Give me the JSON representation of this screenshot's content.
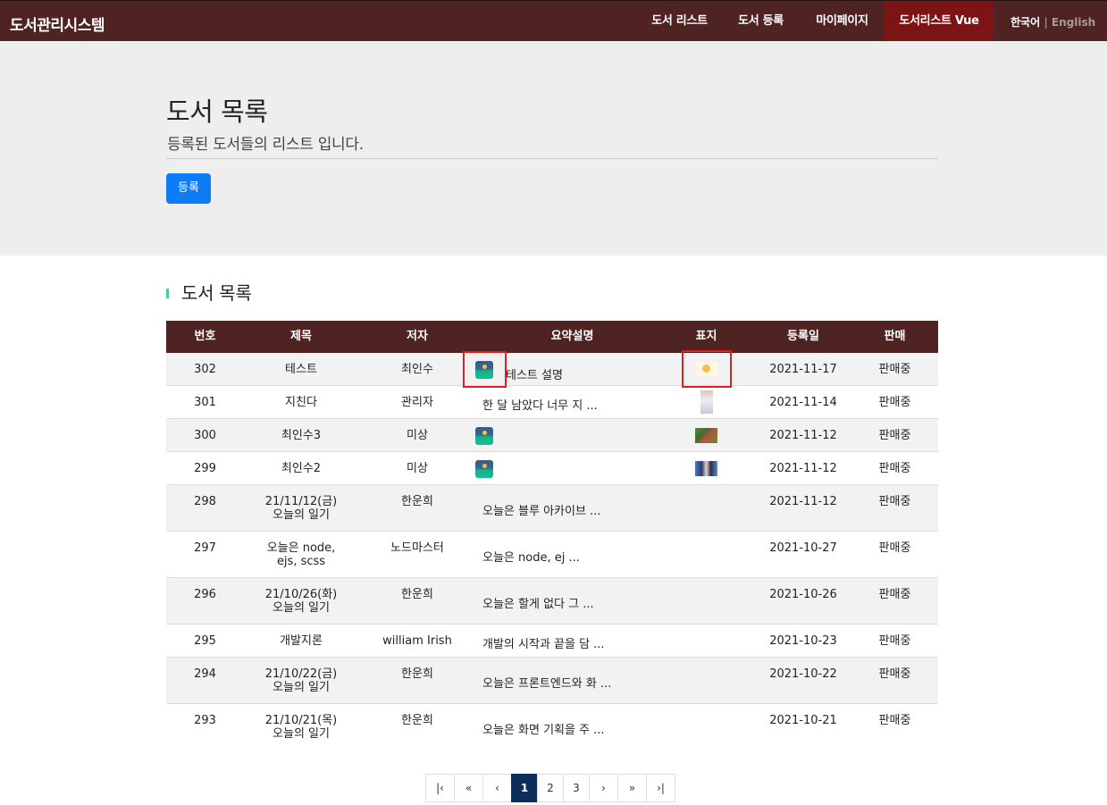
{
  "nav": {
    "brand": "도서관리시스템",
    "items": [
      "도서 리스트",
      "도서 등록",
      "마이페이지",
      "도서리스트 Vue"
    ],
    "lang_ko": "한국어",
    "lang_sep": "|",
    "lang_en": "English"
  },
  "jumbotron": {
    "title": "도서 목록",
    "subtitle": "등록된 도서들의 리스트 입니다.",
    "register_button": "등록"
  },
  "section_title": "도서 목록",
  "table": {
    "headers": [
      "번호",
      "제목",
      "저자",
      "요약설명",
      "표지",
      "등록일",
      "판매"
    ],
    "rows": [
      {
        "num": "302",
        "title": "테스트",
        "author": "최인수",
        "summary": "테스트 설명",
        "date": "2021-11-17",
        "sale": "판매중"
      },
      {
        "num": "301",
        "title": "지친다",
        "author": "관리자",
        "summary": "한 달 남았다 너무 지 ...",
        "date": "2021-11-14",
        "sale": "판매중"
      },
      {
        "num": "300",
        "title": "최인수3",
        "author": "미상",
        "summary": "",
        "date": "2021-11-12",
        "sale": "판매중"
      },
      {
        "num": "299",
        "title": "최인수2",
        "author": "미상",
        "summary": "",
        "date": "2021-11-12",
        "sale": "판매중"
      },
      {
        "num": "298",
        "title": "21/11/12(금) 오늘의 일기",
        "author": "한운희",
        "summary": "오늘은 블루 아카이브 ...",
        "date": "2021-11-12",
        "sale": "판매중"
      },
      {
        "num": "297",
        "title": "오늘은 node, ejs, scss",
        "author": "노드마스터",
        "summary": "오늘은 node, ej ...",
        "date": "2021-10-27",
        "sale": "판매중"
      },
      {
        "num": "296",
        "title": "21/10/26(화) 오늘의 일기",
        "author": "한운희",
        "summary": "오늘은 할게 없다 그 ...",
        "date": "2021-10-26",
        "sale": "판매중"
      },
      {
        "num": "295",
        "title": "개발지론",
        "author": "william Irish",
        "summary": "개발의 시작과 끝을 담 ...",
        "date": "2021-10-23",
        "sale": "판매중"
      },
      {
        "num": "294",
        "title": "21/10/22(금) 오늘의 일기",
        "author": "한운희",
        "summary": "오늘은 프론트엔드와 화 ...",
        "date": "2021-10-22",
        "sale": "판매중"
      },
      {
        "num": "293",
        "title": "21/10/21(목) 오늘의 일기",
        "author": "한운희",
        "summary": "오늘은 화면 기획을 주 ...",
        "date": "2021-10-21",
        "sale": "판매중"
      }
    ]
  },
  "pagination": {
    "first": "|‹",
    "prev_block": "«",
    "prev": "‹",
    "pages": [
      "1",
      "2",
      "3"
    ],
    "current": "1",
    "next": "›",
    "next_block": "»",
    "last": "›|"
  },
  "colors": {
    "navbar": "#4e2322",
    "nav_active": "#7d1414",
    "jumbotron": "#eeeeee",
    "primary_button": "#0d7cf7",
    "accent_bar": "#4cc6a0",
    "highlight_box": "#dd2020",
    "pager_active": "#0e2e5a"
  }
}
